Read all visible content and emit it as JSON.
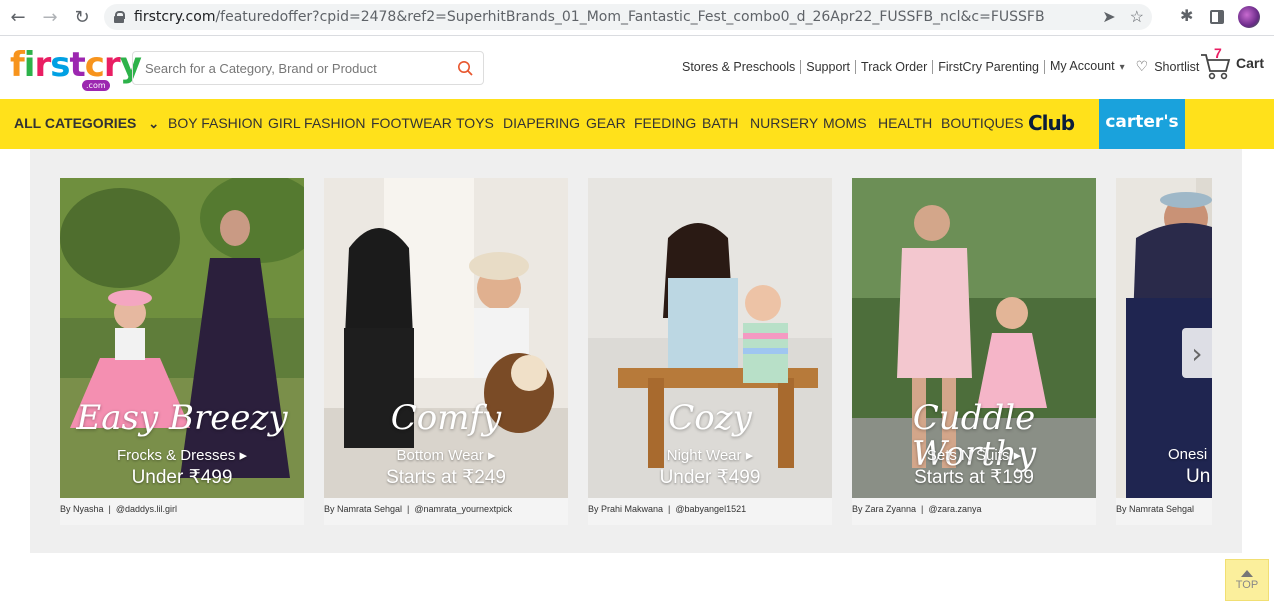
{
  "browser": {
    "url_domain": "firstcry.com",
    "url_rest": "/featuredoffer?cpid=2478&ref2=SuperhitBrands_01_Mom_Fantastic_Fest_combo0_d_26Apr22_FUSSFB_ncl&c=FUSSFB"
  },
  "header": {
    "logo_text": "firstcry",
    "logo_com": ".com",
    "search_placeholder": "Search for a Category, Brand or Product",
    "links": [
      "Stores & Preschools",
      "Support",
      "Track Order",
      "FirstCry Parenting",
      "My Account"
    ],
    "shortlist": "Shortlist",
    "cart_label": "Cart",
    "cart_count": "7"
  },
  "categories": {
    "all": "ALL CATEGORIES",
    "items": [
      "BOY FASHION",
      "GIRL FASHION",
      "FOOTWEAR",
      "TOYS",
      "DIAPERING",
      "GEAR",
      "FEEDING",
      "BATH",
      "NURSERY",
      "MOMS",
      "HEALTH",
      "BOUTIQUES"
    ],
    "club": "Club",
    "carters": "carter's"
  },
  "cards": [
    {
      "script": "Easy Breezy",
      "sub": "Frocks & Dresses",
      "price": "Under ₹499",
      "author": "By Nyasha",
      "handle": "@daddys.lil.girl"
    },
    {
      "script": "Comfy",
      "sub": "Bottom Wear",
      "price": "Starts at ₹249",
      "author": "By Namrata Sehgal",
      "handle": "@namrata_yournextpick"
    },
    {
      "script": "Cozy",
      "sub": "Night Wear",
      "price": "Under ₹499",
      "author": "By Prahi Makwana",
      "handle": "@babyangel1521"
    },
    {
      "script": "Cuddle Worthy",
      "sub": "Sets N Suits",
      "price": "Starts at ₹199",
      "author": "By Zara Zyanna",
      "handle": "@zara.zanya"
    },
    {
      "script": "",
      "sub": "Onesi",
      "price": "Un",
      "author": "By Namrata Sehgal",
      "handle": ""
    }
  ],
  "top_button": "TOP",
  "colors": {
    "category_bar": "#ffe11b",
    "carters_bg": "#1aa2dc",
    "cart_badge": "#e91e63"
  }
}
